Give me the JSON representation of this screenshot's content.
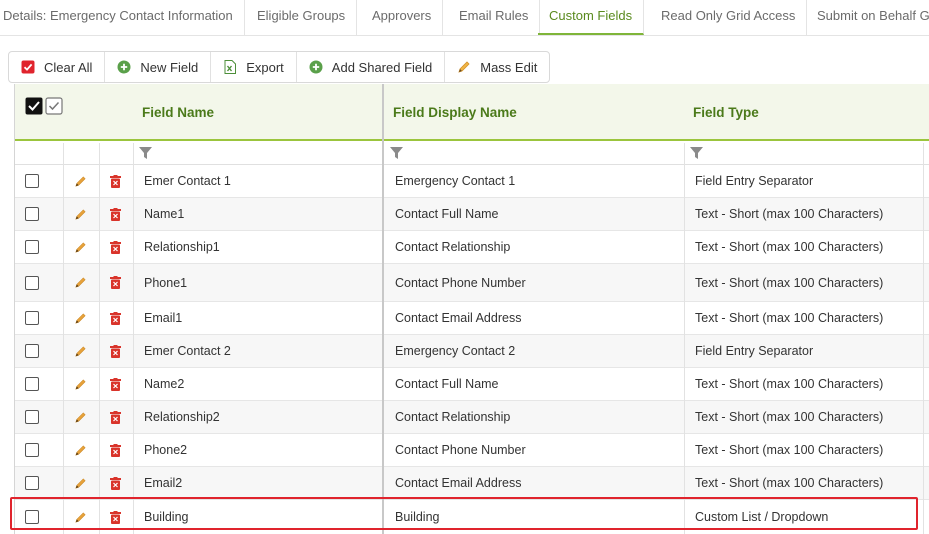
{
  "tabs": [
    {
      "label": "Details: Emergency Contact Information",
      "active": false
    },
    {
      "label": "Eligible Groups",
      "active": false
    },
    {
      "label": "Approvers",
      "active": false
    },
    {
      "label": "Email Rules",
      "active": false
    },
    {
      "label": "Custom Fields",
      "active": true
    },
    {
      "label": "Read Only Grid Access",
      "active": false
    },
    {
      "label": "Submit on Behalf Gr",
      "active": false
    }
  ],
  "toolbar": {
    "clear_all": "Clear All",
    "new_field": "New Field",
    "export": "Export",
    "add_shared_field": "Add Shared Field",
    "mass_edit": "Mass Edit"
  },
  "grid": {
    "columns": {
      "field_name": "Field Name",
      "field_display_name": "Field Display Name",
      "field_type": "Field Type"
    },
    "rows": [
      {
        "field_name": "Emer Contact 1",
        "display_name": "Emergency Contact 1",
        "field_type": "Field Entry Separator"
      },
      {
        "field_name": "Name1",
        "display_name": "Contact Full Name",
        "field_type": "Text - Short (max 100 Characters)"
      },
      {
        "field_name": "Relationship1",
        "display_name": "Contact Relationship",
        "field_type": "Text - Short (max 100 Characters)"
      },
      {
        "field_name": "Phone1",
        "display_name": "Contact Phone Number",
        "field_type": "Text - Short (max 100 Characters)"
      },
      {
        "field_name": "Email1",
        "display_name": "Contact Email Address",
        "field_type": "Text - Short (max 100 Characters)"
      },
      {
        "field_name": "Emer Contact 2",
        "display_name": "Emergency Contact 2",
        "field_type": "Field Entry Separator"
      },
      {
        "field_name": "Name2",
        "display_name": "Contact Full Name",
        "field_type": "Text - Short (max 100 Characters)"
      },
      {
        "field_name": "Relationship2",
        "display_name": "Contact Relationship",
        "field_type": "Text - Short (max 100 Characters)"
      },
      {
        "field_name": "Phone2",
        "display_name": "Contact Phone Number",
        "field_type": "Text - Short (max 100 Characters)"
      },
      {
        "field_name": "Email2",
        "display_name": "Contact Email Address",
        "field_type": "Text - Short (max 100 Characters)"
      },
      {
        "field_name": "Building",
        "display_name": "Building",
        "field_type": "Custom List / Dropdown"
      }
    ]
  },
  "colors": {
    "accent_green": "#7fb539",
    "header_text": "#4b7a1a",
    "highlight_red": "#e0242d",
    "delete_red": "#d9342b",
    "edit_orange": "#e8a23a"
  }
}
